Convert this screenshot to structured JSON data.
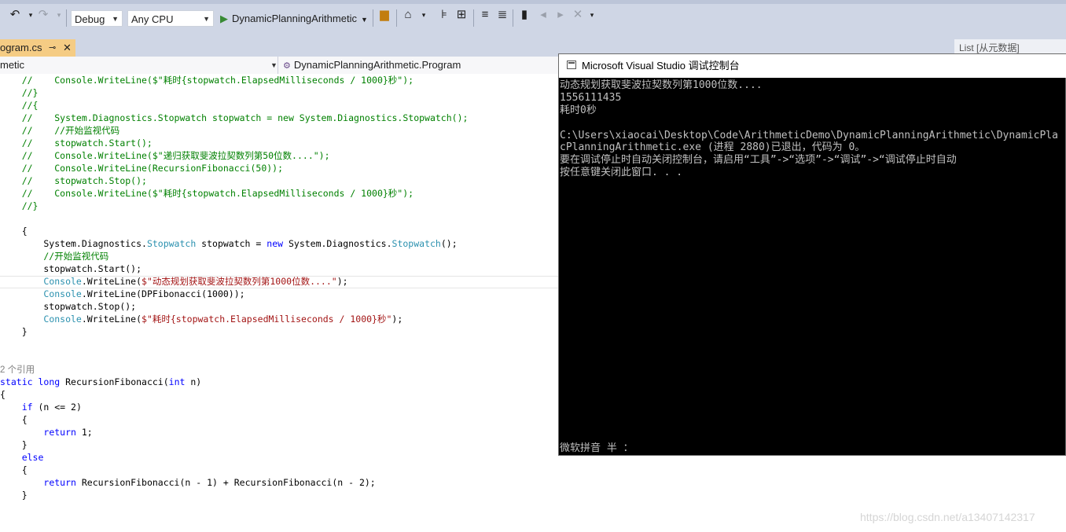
{
  "toolbar": {
    "undo_icon": "undo-icon",
    "redo_icon": "redo-icon",
    "config": "Debug",
    "platform": "Any CPU",
    "startup_project": "DynamicPlanningArithmetic"
  },
  "tabs": {
    "file_tab": "ogram.cs",
    "pin_glyph": "⊸",
    "close_glyph": "✕",
    "list_tab": "List [从元数据]"
  },
  "nav": {
    "left": "metic",
    "right": "DynamicPlanningArithmetic.Program"
  },
  "code_lines": [
    "    //    Console.WriteLine($\"耗时{stopwatch.ElapsedMilliseconds / 1000}秒\");",
    "    //}",
    "    //{",
    "    //    System.Diagnostics.Stopwatch stopwatch = new System.Diagnostics.Stopwatch();",
    "    //    //开始监视代码",
    "    //    stopwatch.Start();",
    "    //    Console.WriteLine($\"递归获取斐波拉契数列第50位数....\");",
    "    //    Console.WriteLine(RecursionFibonacci(50));",
    "    //    stopwatch.Stop();",
    "    //    Console.WriteLine($\"耗时{stopwatch.ElapsedMilliseconds / 1000}秒\");",
    "    //}",
    "",
    "    {",
    "        System.Diagnostics.Stopwatch stopwatch = new System.Diagnostics.Stopwatch();",
    "        //开始监视代码",
    "        stopwatch.Start();",
    "        Console.WriteLine($\"动态规划获取斐波拉契数列第1000位数....\");",
    "        Console.WriteLine(DPFibonacci(1000));",
    "        stopwatch.Stop();",
    "        Console.WriteLine($\"耗时{stopwatch.ElapsedMilliseconds / 1000}秒\");",
    "    }",
    "",
    "",
    "2 个引用",
    "static long RecursionFibonacci(int n)",
    "{",
    "    if (n <= 2)",
    "    {",
    "        return 1;",
    "    }",
    "    else",
    "    {",
    "        return RecursionFibonacci(n - 1) + RecursionFibonacci(n - 2);",
    "    }"
  ],
  "console": {
    "title": "Microsoft Visual Studio 调试控制台",
    "lines": [
      "动态规划获取斐波拉契数列第1000位数....",
      "1556111435",
      "耗时0秒",
      "",
      "C:\\Users\\xiaocai\\Desktop\\Code\\ArithmeticDemo\\DynamicPlanningArithmetic\\DynamicPla",
      "cPlanningArithmetic.exe (进程 2880)已退出，代码为 0。",
      "要在调试停止时自动关闭控制台，请启用“工具”->“选项”->“调试”->“调试停止时自动",
      "按任意键关闭此窗口. . ."
    ],
    "ime": "微软拼音 半 ："
  },
  "watermark": "https://blog.csdn.net/a13407142317"
}
